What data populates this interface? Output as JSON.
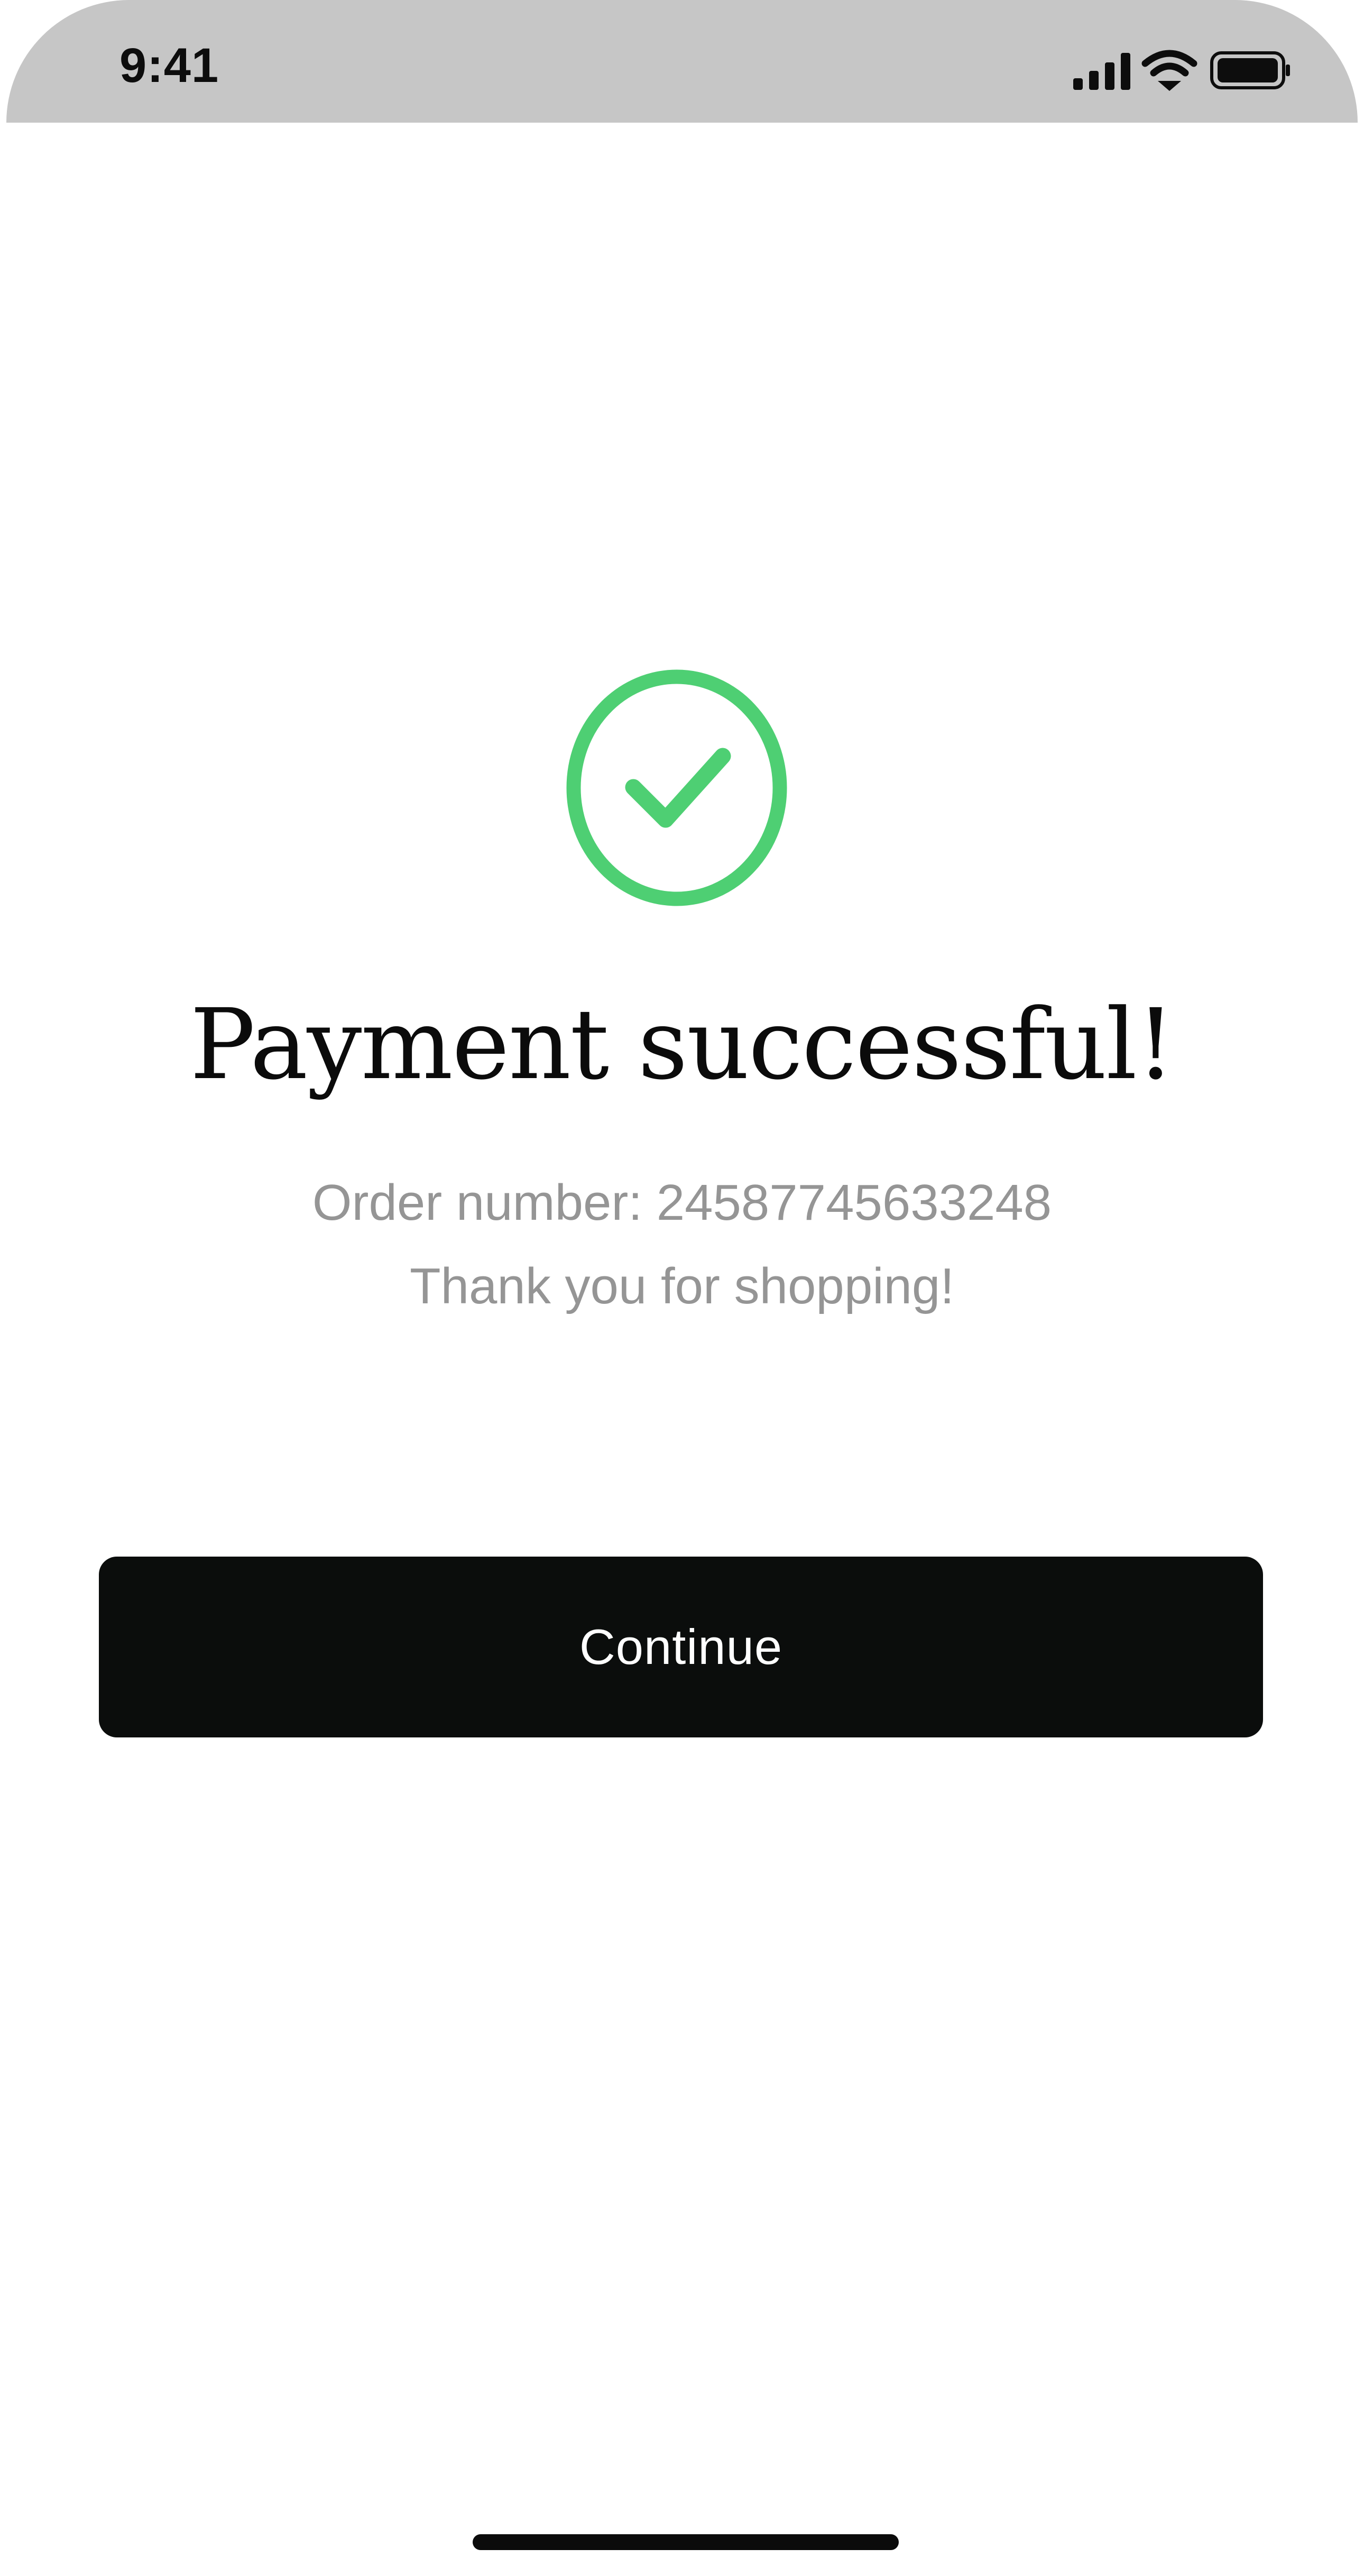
{
  "status_bar": {
    "time": "9:41",
    "icons": [
      "cellular-signal-icon",
      "wifi-icon",
      "battery-icon"
    ]
  },
  "success": {
    "icon": "check-circle-icon",
    "icon_color": "#4ecf73",
    "title": "Payment successful!",
    "order_line": "Order number: 24587745633248",
    "thanks_line": "Thank you for shopping!"
  },
  "actions": {
    "continue_label": "Continue",
    "button_color": "#0b0d0c"
  }
}
